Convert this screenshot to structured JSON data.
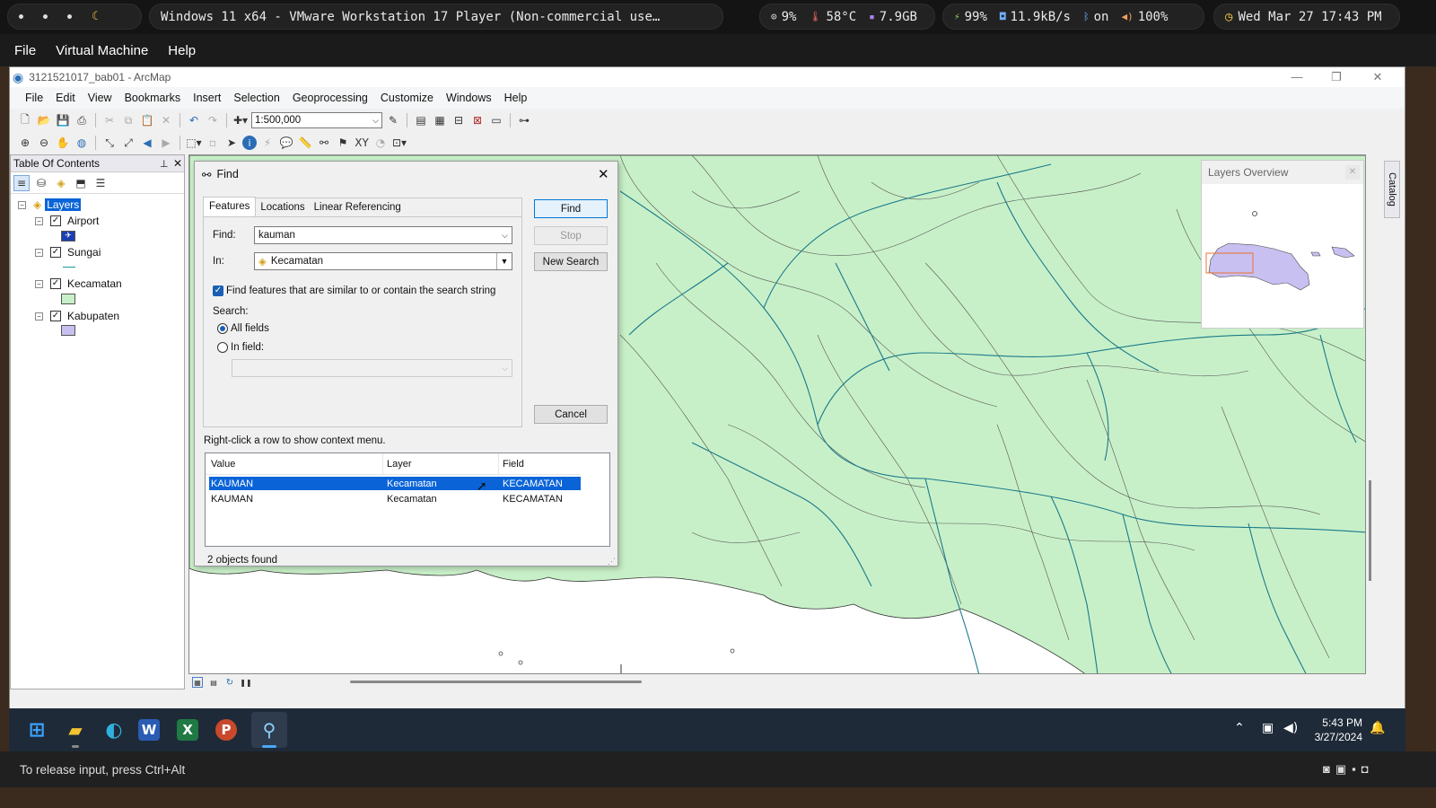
{
  "topbar": {
    "window_title": "Windows 11 x64 - VMware Workstation 17 Player (Non-commercial use…",
    "cpu": "9%",
    "temp": "58°C",
    "mem": "7.9GB",
    "battery": "99%",
    "net": "11.9kB/s",
    "bluetooth": "on",
    "volume": "100%",
    "clock": "Wed Mar 27  17:43 PM"
  },
  "vm_menu": [
    "File",
    "Virtual Machine",
    "Help"
  ],
  "app": {
    "title": "3121521017_bab01 - ArcMap",
    "menu": [
      "File",
      "Edit",
      "View",
      "Bookmarks",
      "Insert",
      "Selection",
      "Geoprocessing",
      "Customize",
      "Windows",
      "Help"
    ],
    "scale": "1:500,000"
  },
  "toc": {
    "title": "Table Of Contents",
    "root": "Layers",
    "layers": [
      {
        "name": "Airport",
        "color": "#1a3fb0"
      },
      {
        "name": "Sungai",
        "color": "#1a9a9a"
      },
      {
        "name": "Kecamatan",
        "color": "#c8f0c8"
      },
      {
        "name": "Kabupaten",
        "color": "#c8c0f0"
      }
    ]
  },
  "find_dialog": {
    "title": "Find",
    "tabs": [
      "Features",
      "Locations",
      "Linear Referencing"
    ],
    "find_label": "Find:",
    "find_value": "kauman",
    "in_label": "In:",
    "in_value": "Kecamatan",
    "similar_label": "Find features that are similar to or contain the search string",
    "search_label": "Search:",
    "all_fields": "All fields",
    "in_field": "In field:",
    "buttons": {
      "find": "Find",
      "stop": "Stop",
      "new_search": "New Search",
      "cancel": "Cancel"
    },
    "hint": "Right-click a row to show context menu.",
    "columns": [
      "Value",
      "Layer",
      "Field"
    ],
    "rows": [
      {
        "value": "KAUMAN",
        "layer": "Kecamatan",
        "field": "KECAMATAN"
      },
      {
        "value": "KAUMAN",
        "layer": "Kecamatan",
        "field": "KECAMATAN"
      }
    ],
    "status": "2 objects found"
  },
  "overview": {
    "title": "Layers Overview"
  },
  "catalog_tab": "Catalog",
  "taskbar": {
    "time": "5:43 PM",
    "date": "3/27/2024"
  },
  "vm_status": "To release input, press Ctrl+Alt",
  "colors": {
    "map_fill": "#c8f0c8",
    "river": "#1a7a8a",
    "selection": "#0a64d8"
  }
}
